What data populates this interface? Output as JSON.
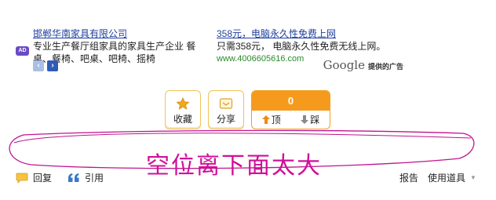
{
  "ad": {
    "badge": "AD",
    "left": {
      "title": "邯郸华南家具有限公司",
      "desc": "专业生产餐厅组家具的家具生产企业 餐桌、餐椅、吧桌、吧椅、摇椅"
    },
    "right": {
      "title": "358元，电脑永久性免费上网",
      "desc": "只需358元， 电脑永久性免费无线上网。",
      "url": "www.4006605616.com"
    },
    "google_word": "Google",
    "google_sub": "提供的广告"
  },
  "actions": {
    "favorite_label": "收藏",
    "share_label": "分享",
    "vote_count": "0",
    "up_label": "顶",
    "down_label": "踩"
  },
  "annotation": {
    "text": "空位离下面太大",
    "color": "#d0109a"
  },
  "bottom": {
    "reply_label": "回复",
    "quote_label": "引用",
    "report_label": "报告",
    "tools_label": "使用道具"
  }
}
